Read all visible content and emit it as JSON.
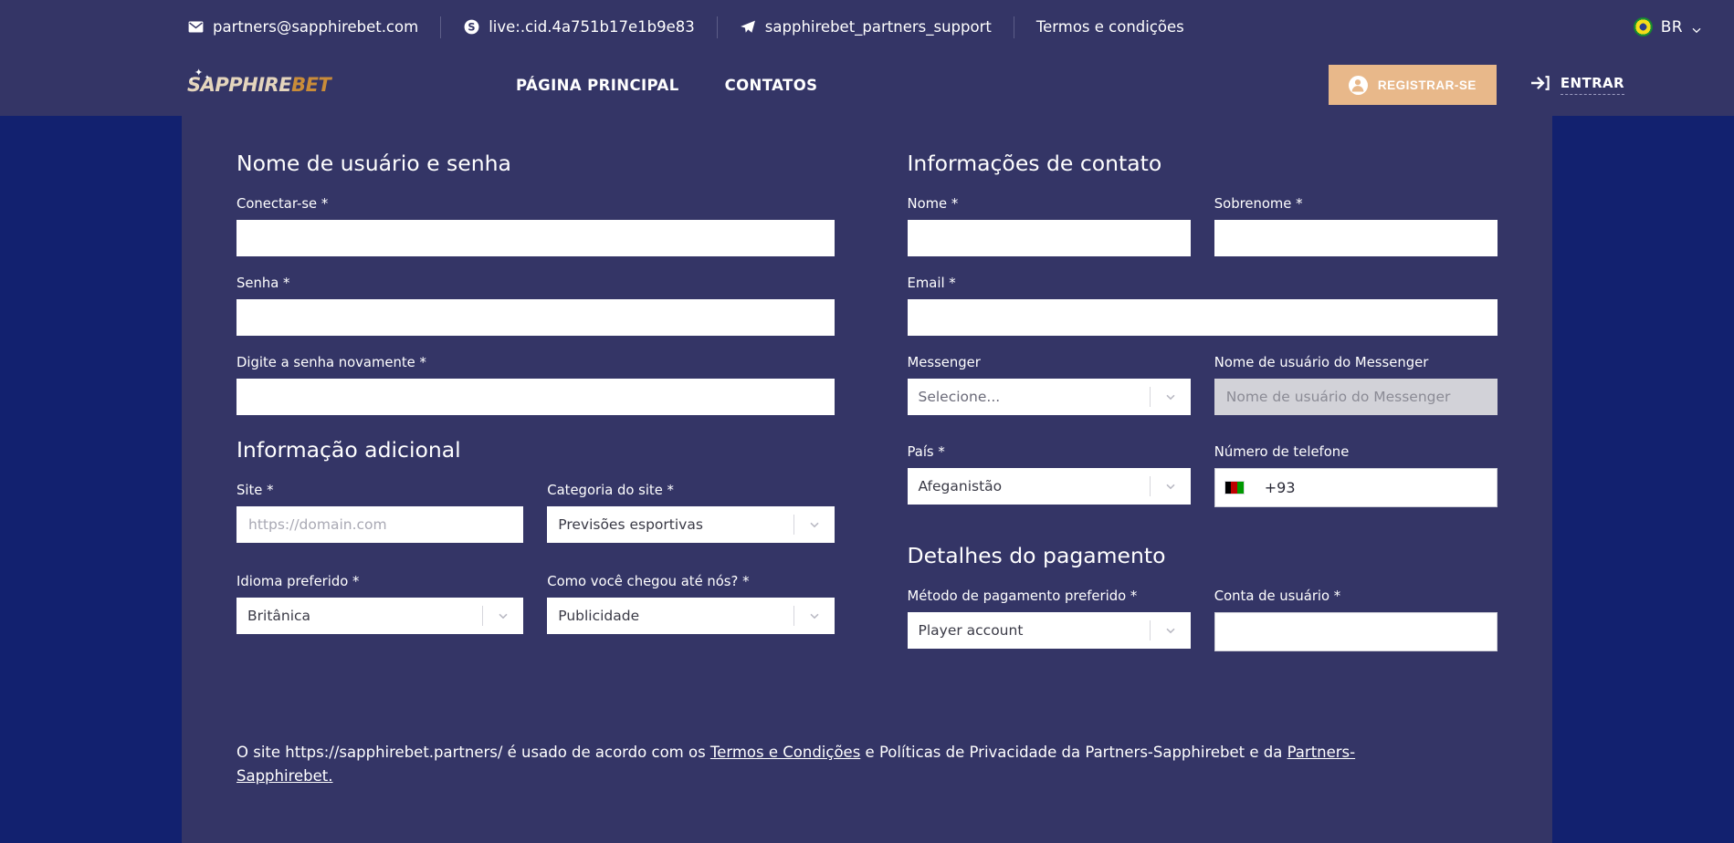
{
  "topbar": {
    "contacts": [
      {
        "icon": "envelope-icon",
        "label": "partners@sapphirebet.com"
      },
      {
        "icon": "skype-icon",
        "label": "live:.cid.4a751b17e1b9e83"
      },
      {
        "icon": "telegram-icon",
        "label": "sapphirebet_partners_support"
      }
    ],
    "terms_label": "Termos e condições",
    "language": {
      "code": "BR",
      "flag": "brazil-flag-icon"
    }
  },
  "header": {
    "logo": {
      "part1": "SAPPHIRE",
      "part2": "BET"
    },
    "nav": [
      {
        "label": "PÁGINA PRINCIPAL"
      },
      {
        "label": "CONTATOS"
      }
    ],
    "register_label": "REGISTRAR-SE",
    "login_label": "ENTRAR"
  },
  "form": {
    "sections": {
      "credentials_title": "Nome de usuário e senha",
      "additional_title": "Informação adicional",
      "contact_title": "Informações de contato",
      "payment_title": "Detalhes do pagamento"
    },
    "login": {
      "label": "Conectar-se *",
      "value": "",
      "placeholder": ""
    },
    "password": {
      "label": "Senha *",
      "value": "",
      "placeholder": ""
    },
    "password_repeat": {
      "label": "Digite a senha novamente *",
      "value": "",
      "placeholder": ""
    },
    "site": {
      "label": "Site *",
      "value": "",
      "placeholder": "https://domain.com"
    },
    "site_category": {
      "label": "Categoria do site *",
      "value": "Previsões esportivas"
    },
    "language_pref": {
      "label": "Idioma preferido *",
      "value": "Britânica"
    },
    "how_found": {
      "label": "Como você chegou até nós? *",
      "value": "Publicidade"
    },
    "first_name": {
      "label": "Nome *",
      "value": "",
      "placeholder": ""
    },
    "last_name": {
      "label": "Sobrenome *",
      "value": "",
      "placeholder": ""
    },
    "email": {
      "label": "Email *",
      "value": "",
      "placeholder": ""
    },
    "messenger": {
      "label": "Messenger",
      "value": "Selecione..."
    },
    "messenger_username": {
      "label": "Nome de usuário do Messenger",
      "value": "",
      "placeholder": "Nome de usuário do Messenger"
    },
    "country": {
      "label": "País *",
      "value": "Afeganistão"
    },
    "phone": {
      "label": "Número de telefone",
      "value": "+93",
      "flag": "afghanistan-flag-icon"
    },
    "payment_method": {
      "label": "Método de pagamento preferido *",
      "value": "Player account"
    },
    "user_account": {
      "label": "Conta de usuário *",
      "value": "",
      "placeholder": ""
    }
  },
  "legal": {
    "part1": "O site https://sapphirebet.partners/ é usado de acordo com os ",
    "link1": "Termos e Condições",
    "part2": " e Políticas de Privacidade da Partners-Sapphirebet e da ",
    "link2": "Partners-Sapphirebet."
  },
  "colors": {
    "page_bg": "#12216f",
    "panel_bg": "#343566",
    "accent": "#e8b88a",
    "logo_gold": "#c98c39",
    "logo_cream": "#e4d5bd"
  }
}
